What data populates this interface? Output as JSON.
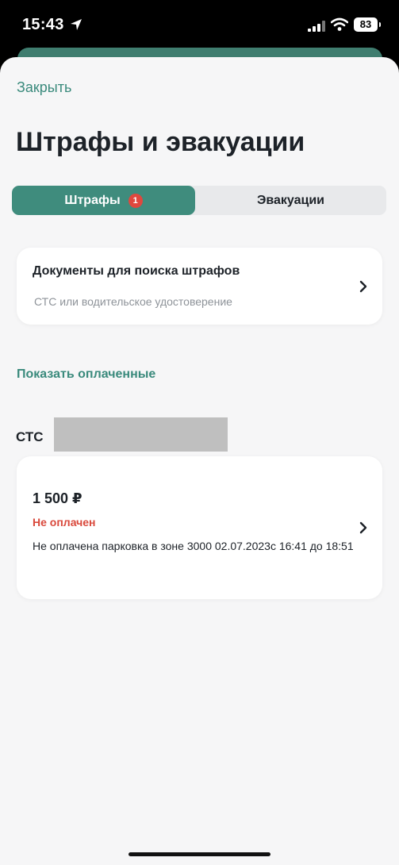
{
  "status_bar": {
    "time": "15:43",
    "battery": "83"
  },
  "header": {
    "close_label": "Закрыть",
    "title": "Штрафы и эвакуации"
  },
  "tabs": [
    {
      "label": "Штрафы",
      "badge": "1",
      "active": true
    },
    {
      "label": "Эвакуации",
      "active": false
    }
  ],
  "documents_card": {
    "title": "Документы для поиска штрафов",
    "subtitle": "СТС или водительское удостоверение"
  },
  "show_paid_label": "Показать оплаченные",
  "vehicle": {
    "label": "СТС"
  },
  "fine": {
    "amount": "1 500 ₽",
    "status": "Не оплачен",
    "description": "Не оплачена парковка в зоне  3000 02.07.2023с 16:41 до 18:51"
  },
  "colors": {
    "accent": "#3f8c7d",
    "link": "#3a8a7c",
    "unpaid": "#d9483b",
    "badge": "#e0473e"
  }
}
